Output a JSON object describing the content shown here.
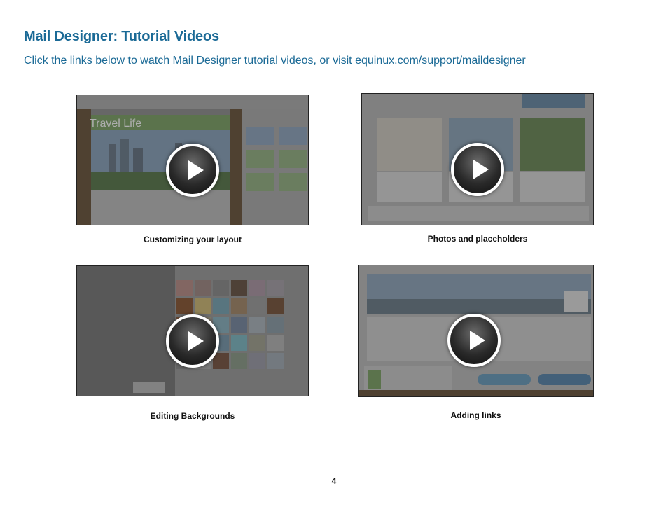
{
  "page": {
    "title": "Mail Designer: Tutorial Videos",
    "subtitle": "Click the links below to watch Mail Designer tutorial videos, or visit equinux.com/support/maildesigner",
    "page_number": "4"
  },
  "videos": [
    {
      "caption": "Customizing your layout",
      "thumb_text": "Travel Life",
      "icon": "play-icon"
    },
    {
      "caption": "Photos and placeholders",
      "icon": "play-icon"
    },
    {
      "caption": "Editing Backgrounds",
      "icon": "play-icon"
    },
    {
      "caption": "Adding links",
      "icon": "play-icon"
    }
  ],
  "colors": {
    "heading": "#1b6a96"
  }
}
